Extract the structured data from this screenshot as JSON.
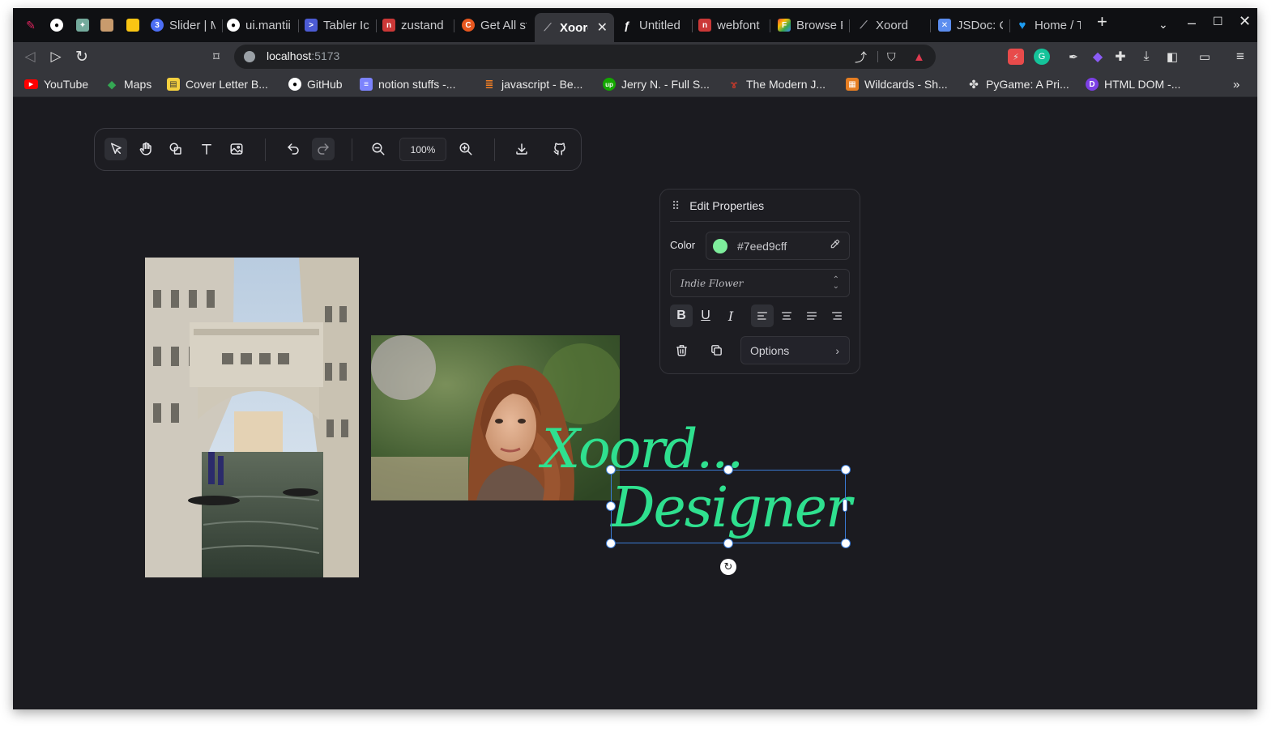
{
  "browser": {
    "tabs": [
      {
        "label": "",
        "icon": "feather-icon",
        "color": "#e0245e"
      },
      {
        "label": "",
        "icon": "github-icon",
        "color": "#ffffff"
      },
      {
        "label": "",
        "icon": "chatgpt-icon",
        "color": "#74aa9c"
      },
      {
        "label": "",
        "icon": "photo-icon",
        "color": "#c89b6d"
      },
      {
        "label": "",
        "icon": "keep-icon",
        "color": "#f9c513"
      },
      {
        "label": "Slider | M",
        "icon": "mantine-icon",
        "color": "#4c6ef5"
      },
      {
        "label": "ui.mantii",
        "icon": "github-icon",
        "color": "#ffffff"
      },
      {
        "label": "Tabler Ic",
        "icon": "terminal-icon",
        "color": "#4c5bd4"
      },
      {
        "label": "zustand",
        "icon": "npm-icon",
        "color": "#cb3837"
      },
      {
        "label": "Get All st",
        "icon": "codeg-icon",
        "color": "#e8571f"
      },
      {
        "label": "Xoord",
        "icon": "xoord-icon",
        "color": "#9a9aa0",
        "active": true
      },
      {
        "label": "Untitled",
        "icon": "figma-icon",
        "color": "#ffffff"
      },
      {
        "label": "webfont",
        "icon": "npm-icon",
        "color": "#cb3837"
      },
      {
        "label": "Browse F",
        "icon": "fonts-icon",
        "color": "#ea4335"
      },
      {
        "label": "Xoord",
        "icon": "xoord-icon",
        "color": "#9a9aa0"
      },
      {
        "label": "JSDoc: C",
        "icon": "jsdoc-icon",
        "color": "#5b8def"
      },
      {
        "label": "Home / T",
        "icon": "twitter-icon",
        "color": "#1d9bf0"
      }
    ],
    "new_tab": "+",
    "address": {
      "host": "localhost",
      "port": ":5173"
    },
    "bookmarks": [
      {
        "label": "YouTube",
        "icon": "youtube-icon",
        "color": "#ff0000"
      },
      {
        "label": "Maps",
        "icon": "maps-icon",
        "color": "#34a853"
      },
      {
        "label": "Cover Letter B...",
        "icon": "doc-icon",
        "color": "#f4d03f"
      },
      {
        "label": "GitHub",
        "icon": "github-icon",
        "color": "#ffffff"
      },
      {
        "label": "notion stuffs -...",
        "icon": "notion-icon",
        "color": "#7c83fd"
      },
      {
        "label": "javascript - Be...",
        "icon": "stackoverflow-icon",
        "color": "#f48024"
      },
      {
        "label": "Jerry N. - Full S...",
        "icon": "upwork-icon",
        "color": "#14a800"
      },
      {
        "label": "The Modern J...",
        "icon": "js-icon",
        "color": "#c0392b"
      },
      {
        "label": "Wildcards - Sh...",
        "icon": "wildcards-icon",
        "color": "#e67e22"
      },
      {
        "label": "PyGame: A Pri...",
        "icon": "pygame-icon",
        "color": "#dddddd"
      },
      {
        "label": "HTML DOM -...",
        "icon": "dom-icon",
        "color": "#7b3fe4"
      }
    ]
  },
  "editor": {
    "zoom": "100%",
    "canvas_text": {
      "line1": "Xoord...",
      "line2": "Designer"
    },
    "properties": {
      "title": "Edit Properties",
      "color_label": "Color",
      "color_value": "#7eed9cff",
      "color_hex": "#7eed9c",
      "font": "Indie Flower",
      "options_label": "Options"
    }
  }
}
